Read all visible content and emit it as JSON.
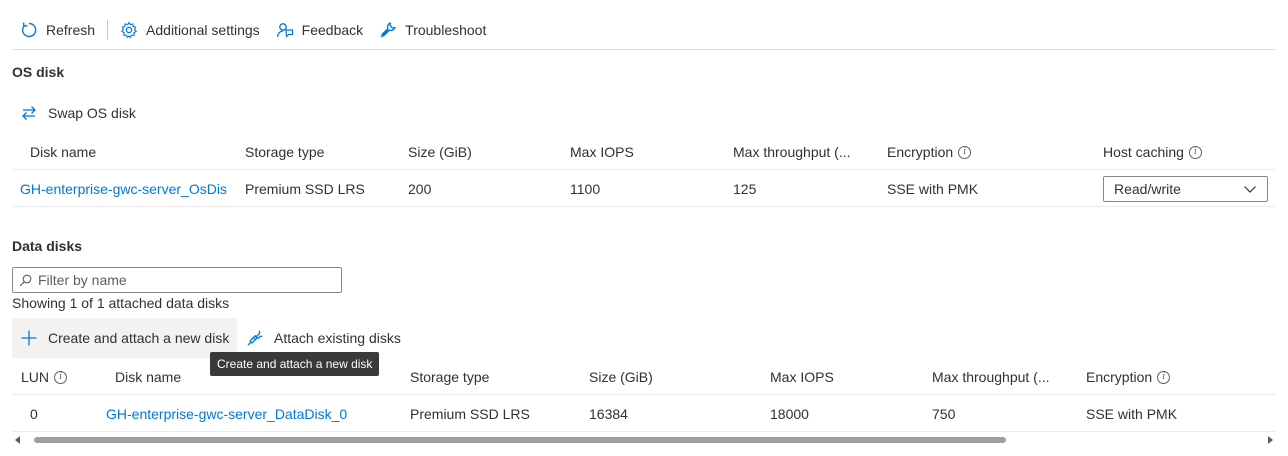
{
  "toolbar": {
    "refresh": "Refresh",
    "additional_settings": "Additional settings",
    "feedback": "Feedback",
    "troubleshoot": "Troubleshoot"
  },
  "os_disk": {
    "title": "OS disk",
    "swap_label": "Swap OS disk",
    "columns": [
      "Disk name",
      "Storage type",
      "Size (GiB)",
      "Max IOPS",
      "Max throughput (...",
      "Encryption",
      "Host caching"
    ],
    "row": {
      "disk_name": "GH-enterprise-gwc-server_OsDis",
      "storage_type": "Premium SSD LRS",
      "size": "200",
      "max_iops": "1100",
      "max_throughput": "125",
      "encryption": "SSE with PMK",
      "host_caching": "Read/write"
    }
  },
  "data_disks": {
    "title": "Data disks",
    "filter_placeholder": "Filter by name",
    "showing": "Showing 1 of 1 attached data disks",
    "create_label": "Create and attach a new disk",
    "attach_label": "Attach existing disks",
    "tooltip": "Create and attach a new disk",
    "columns": [
      "LUN",
      "Disk name",
      "Storage type",
      "Size (GiB)",
      "Max IOPS",
      "Max throughput (...",
      "Encryption"
    ],
    "rows": [
      {
        "lun": "0",
        "disk_name": "GH-enterprise-gwc-server_DataDisk_0",
        "storage_type": "Premium SSD LRS",
        "size": "16384",
        "max_iops": "18000",
        "max_throughput": "750",
        "encryption": "SSE with PMK"
      }
    ]
  },
  "colors": {
    "accent": "#0078d4",
    "text": "#323130",
    "tooltip_bg": "#3b3a39"
  }
}
